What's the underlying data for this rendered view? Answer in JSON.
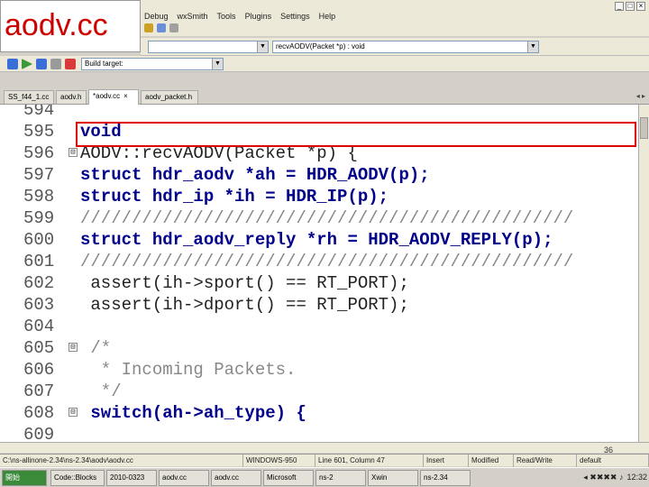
{
  "slide_title": "aodv.cc",
  "menubar": {
    "items": [
      "Debug",
      "wxSmith",
      "Tools",
      "Plugins",
      "Settings",
      "Help"
    ]
  },
  "funcbar": {
    "scope_value": "",
    "function_value": "recvAODV(Packet *p) : void"
  },
  "toolbar": {
    "build_target_label": "Build target:"
  },
  "tabs": [
    {
      "label": "SS_f44_1.cc",
      "active": false
    },
    {
      "label": "aodv.h",
      "active": false
    },
    {
      "label": "*aodv.cc",
      "active": true,
      "close": "×"
    },
    {
      "label": "aodv_packet.h",
      "active": false
    }
  ],
  "editor": {
    "lines": [
      {
        "num": "594",
        "code": "",
        "fold": ""
      },
      {
        "num": "595",
        "code": "void",
        "fold": ""
      },
      {
        "num": "596",
        "code": "AODV::recvAODV(Packet *p) {",
        "fold": "⊟"
      },
      {
        "num": "597",
        "code": "struct hdr_aodv *ah = HDR_AODV(p);",
        "fold": ""
      },
      {
        "num": "598",
        "code": "struct hdr_ip *ih = HDR_IP(p);",
        "fold": ""
      },
      {
        "num": "599",
        "code": "////////////////////////////////////////////////",
        "fold": ""
      },
      {
        "num": "600",
        "code": "struct hdr_aodv_reply *rh = HDR_AODV_REPLY(p);",
        "fold": ""
      },
      {
        "num": "601",
        "code": "////////////////////////////////////////////////",
        "fold": ""
      },
      {
        "num": "602",
        "code": " assert(ih->sport() == RT_PORT);",
        "fold": ""
      },
      {
        "num": "603",
        "code": " assert(ih->dport() == RT_PORT);",
        "fold": ""
      },
      {
        "num": "604",
        "code": "",
        "fold": ""
      },
      {
        "num": "605",
        "code": " /*",
        "fold": "⊟"
      },
      {
        "num": "606",
        "code": "  * Incoming Packets.",
        "fold": ""
      },
      {
        "num": "607",
        "code": "  */",
        "fold": ""
      },
      {
        "num": "608",
        "code": " switch(ah->ah_type) {",
        "fold": "⊟"
      },
      {
        "num": "609",
        "code": "",
        "fold": ""
      }
    ],
    "highlighted_line": "600",
    "page_number": "36"
  },
  "statusbar": {
    "cells": [
      "C:\\ns-allinone-2.34\\ns-2.34\\aodv\\aodv.cc",
      "WINDOWS-950",
      "Line 601, Column 47",
      "Insert",
      "Modified",
      "Read/Write",
      "default"
    ]
  },
  "taskbar": {
    "tasks": [
      "開始",
      "Code::Blocks",
      "2010-0323",
      "aodv.cc",
      "aodv.cc",
      "Microsoft",
      "ns-2",
      "Xwin",
      "ns-2.34"
    ],
    "clock": "12:32"
  }
}
